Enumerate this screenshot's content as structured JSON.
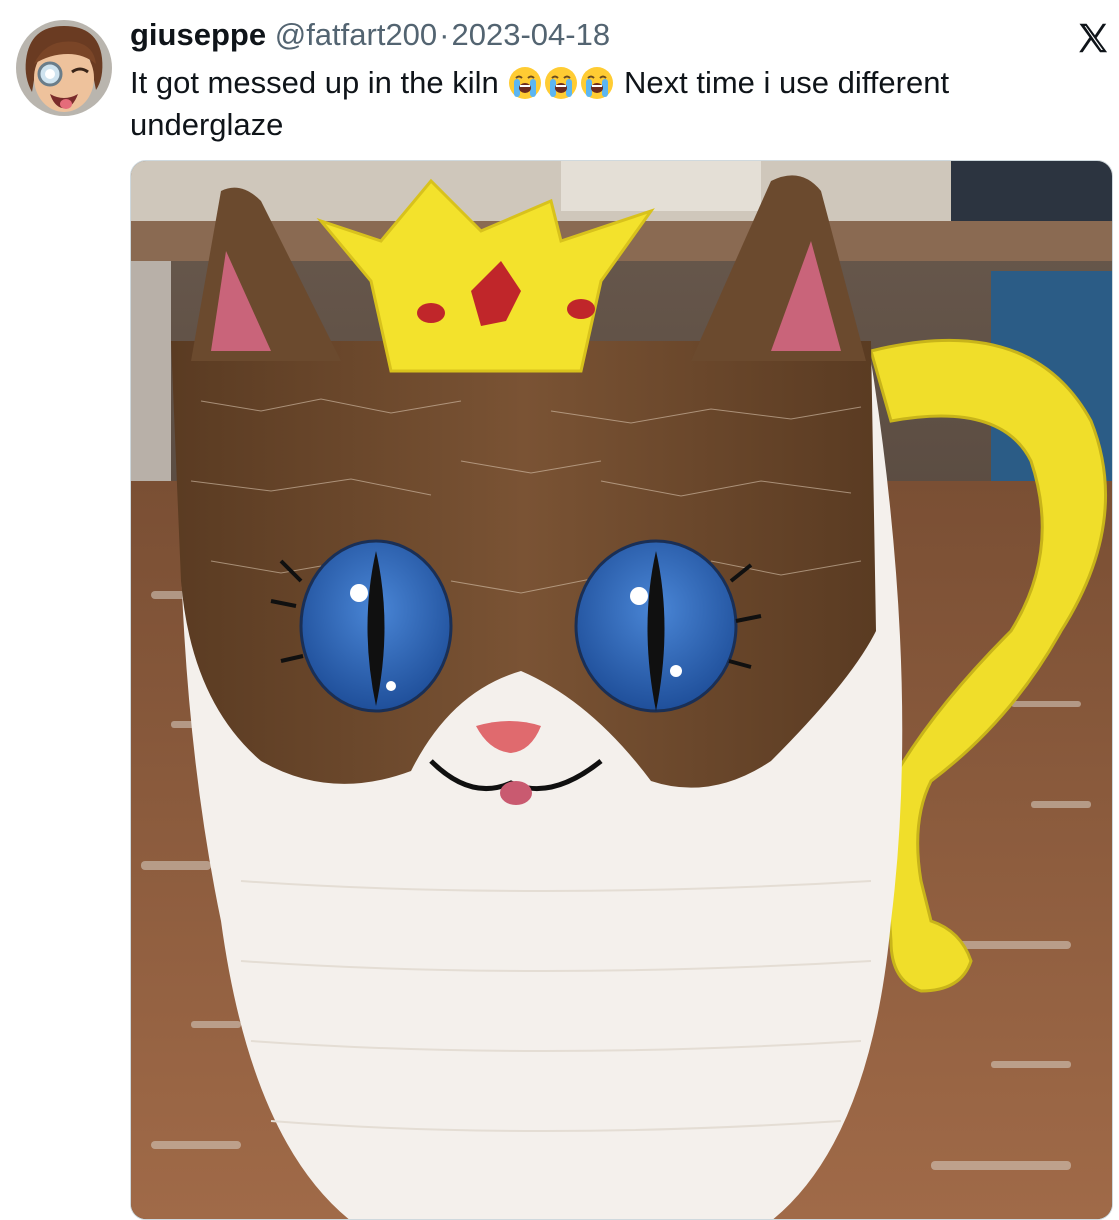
{
  "tweet": {
    "author": {
      "display_name": "giuseppe",
      "handle": "@fatfart200",
      "avatar_icon": "avatar-cartoon-face-icon"
    },
    "separator": "·",
    "date": "2023-04-18",
    "text_parts": {
      "before_emojis": "It got messed up in the kiln ",
      "emojis": [
        "loudly-crying-face-icon",
        "loudly-crying-face-icon",
        "loudly-crying-face-icon"
      ],
      "after_emojis": " Next time i use different underglaze"
    },
    "platform_icon": "x-logo-icon",
    "media": {
      "type": "photo",
      "icon": "cat-mug-photo"
    }
  },
  "colors": {
    "text_primary": "#0f1419",
    "text_secondary": "#536471",
    "mug_brown": "#6b4a2e",
    "mug_white": "#f4f0ec",
    "mug_yellow": "#f3e22c",
    "eye_blue": "#2a66b8",
    "table_wood": "#8a5a3c"
  }
}
